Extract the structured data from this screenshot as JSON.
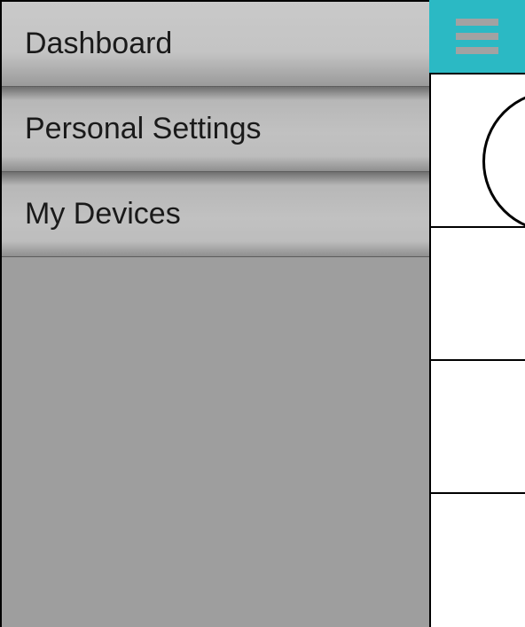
{
  "drawer": {
    "items": [
      {
        "label": "Dashboard"
      },
      {
        "label": "Personal Settings"
      },
      {
        "label": "My Devices"
      }
    ]
  },
  "header": {
    "menu_icon": "hamburger"
  }
}
